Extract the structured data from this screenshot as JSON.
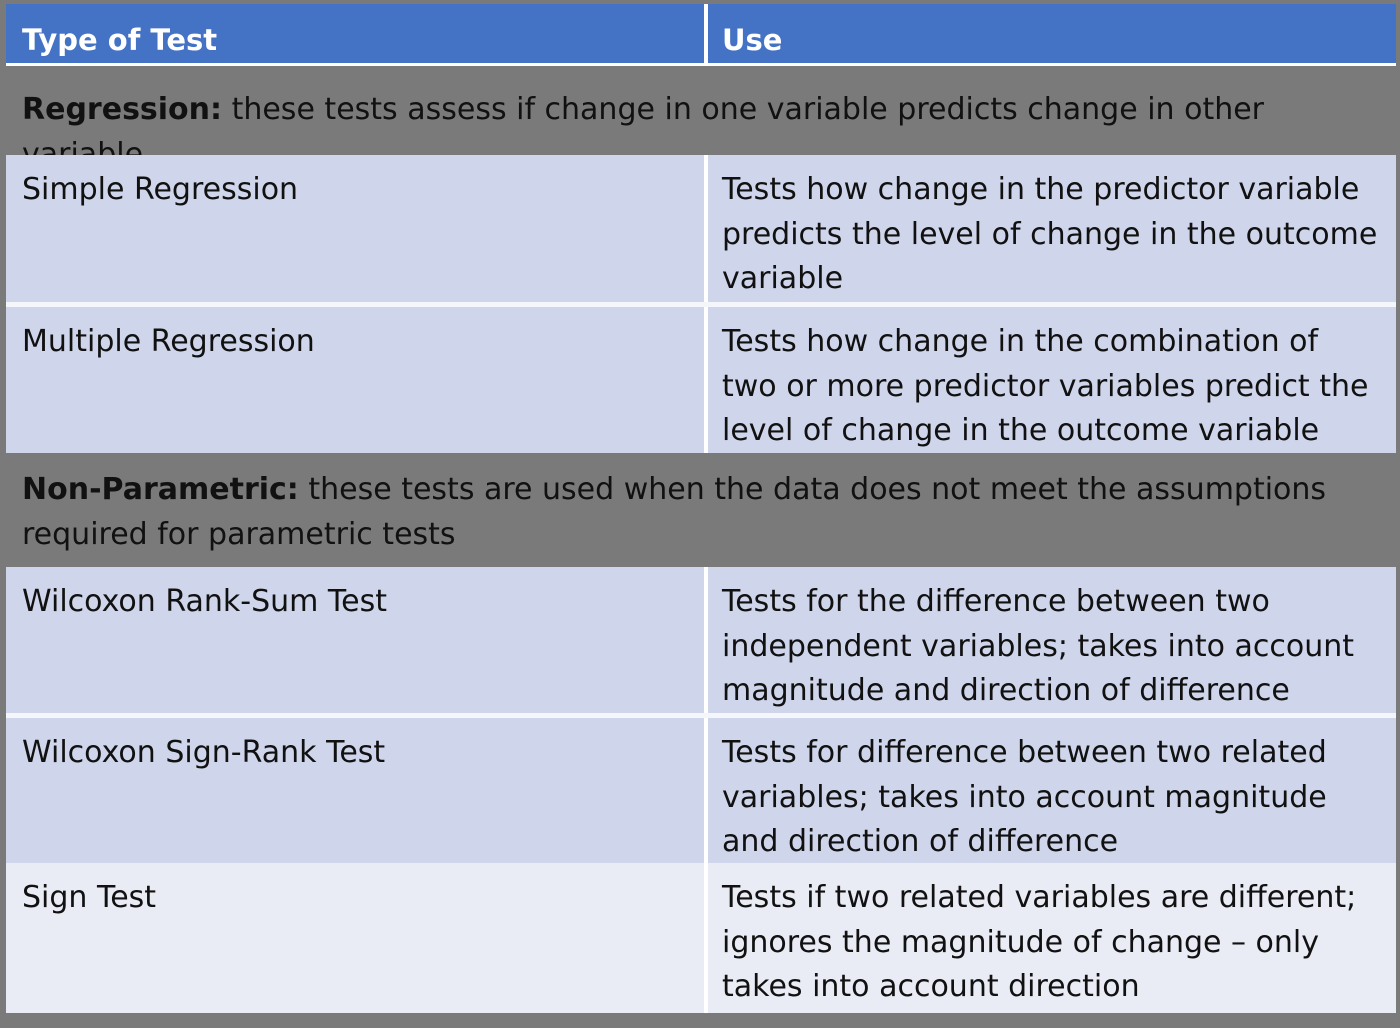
{
  "table": {
    "headers": [
      "Type of Test",
      "Use"
    ],
    "sections": [
      {
        "title": "Regression:",
        "description": "these tests assess if change in one variable predicts change in other variable",
        "rows": [
          {
            "test": "Simple Regression",
            "use": "Tests how change in the predictor variable predicts the level of change in the outcome variable"
          },
          {
            "test": "Multiple Regression",
            "use": "Tests how change in the combination of two or more predictor variables predict the level of change in the outcome variable"
          }
        ]
      },
      {
        "title": "Non-Parametric:",
        "description": "these tests are used when the data does not meet the assumptions required for parametric tests",
        "rows": [
          {
            "test": "Wilcoxon Rank-Sum Test",
            "use": "Tests for the difference between two independent variables; takes into account magnitude and direction of difference"
          },
          {
            "test": "Wilcoxon Sign-Rank Test",
            "use": "Tests for difference between two related variables; takes into account magnitude and direction of difference"
          },
          {
            "test": "Sign Test",
            "use": "Tests if two related variables are different; ignores the magnitude of change – only takes into account direction"
          }
        ]
      }
    ]
  },
  "colors": {
    "header_bg": "#4472c4",
    "section_bg": "#7a7a7a",
    "row_bg": "#cfd5ea",
    "row_bg_light": "#e9ebf5"
  }
}
